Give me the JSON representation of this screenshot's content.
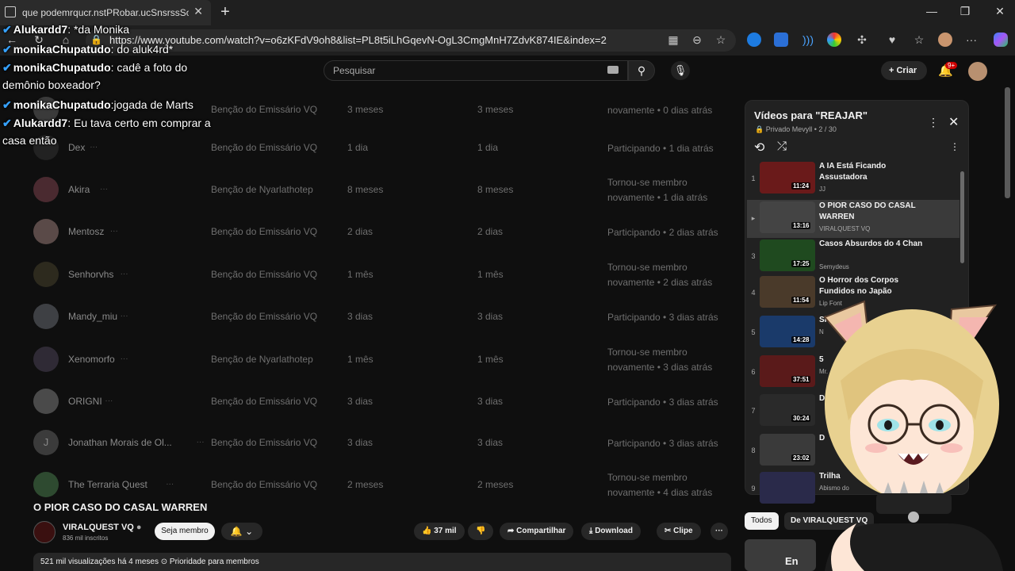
{
  "browser": {
    "tab_title": "que podemrqucr.nstPRobar.ucSnsrssSoCSAL WA",
    "url": "https://www.youtube.com/watch?v=o6zKFdV9oh8&list=PL8t5iLhGqevN-OgL3CmgMnH7ZdvK874IE&index=2"
  },
  "header": {
    "search_placeholder": "Pesquisar",
    "create_label": "Criar",
    "notif_count": "9+"
  },
  "members": [
    {
      "name": "",
      "tier": "Benção do Emissário VQ",
      "t1": "3 meses",
      "t2": "3 meses",
      "status": "novamente • 0 dias atrás",
      "color": "#3a3a3a"
    },
    {
      "name": "Dex",
      "tier": "Benção do Emissário VQ",
      "t1": "1 dia",
      "t2": "1 dia",
      "status": "Participando • 1 dia atrás",
      "color": "#222222"
    },
    {
      "name": "Akira",
      "tier": "Benção de Nyarlathotep",
      "t1": "8 meses",
      "t2": "8 meses",
      "status": "Tornou-se membro novamente • 1 dia atrás",
      "color": "#4a2a30"
    },
    {
      "name": "Mentosz",
      "tier": "Benção do Emissário VQ",
      "t1": "2 dias",
      "t2": "2 dias",
      "status": "Participando • 2 dias atrás",
      "color": "#5a4a48"
    },
    {
      "name": "Senhorvhs",
      "tier": "Benção do Emissário VQ",
      "t1": "1 mês",
      "t2": "1 mês",
      "status": "Tornou-se membro novamente • 2 dias atrás",
      "color": "#2d2a1e"
    },
    {
      "name": "Mandy_miu",
      "tier": "Benção do Emissário VQ",
      "t1": "3 dias",
      "t2": "3 dias",
      "status": "Participando • 3 dias atrás",
      "color": "#3e4044"
    },
    {
      "name": "Xenomorfo",
      "tier": "Benção de Nyarlathotep",
      "t1": "1 mês",
      "t2": "1 mês",
      "status": "Tornou-se membro novamente • 3 dias atrás",
      "color": "#2f2a35"
    },
    {
      "name": "ORIGNI",
      "tier": "Benção do Emissário VQ",
      "t1": "3 dias",
      "t2": "3 dias",
      "status": "Participando • 3 dias atrás",
      "color": "#4a4a4a"
    },
    {
      "name": "Jonathan Morais de Ol...",
      "tier": "Benção do Emissário VQ",
      "t1": "3 dias",
      "t2": "3 dias",
      "status": "Participando • 3 dias atrás",
      "color": "#3b3b3b",
      "initial": "J"
    },
    {
      "name": "The Terraria Quest",
      "tier": "Benção do Emissário VQ",
      "t1": "2 meses",
      "t2": "2 meses",
      "status": "Tornou-se membro novamente • 4 dias atrás",
      "color": "#2e4a30"
    }
  ],
  "playlist": {
    "title": "Vídeos para \"REAJAR\"",
    "sub": "🔒 Privado  Mevyll • 2 / 30",
    "items": [
      {
        "num": "1",
        "title": "A IA Está Ficando Assustadora",
        "channel": "JJ",
        "dur": "11:24",
        "color": "#6a1a1a"
      },
      {
        "num": "▸",
        "title": "O PIOR CASO DO CASAL WARREN",
        "channel": "VIRALQUEST VQ",
        "dur": "13:16",
        "color": "#444444"
      },
      {
        "num": "3",
        "title": "Casos Absurdos do 4 Chan",
        "channel": "Semydeus",
        "dur": "17:25",
        "color": "#1f4a1f"
      },
      {
        "num": "4",
        "title": "O Horror dos Corpos Fundidos no Japão",
        "channel": "Lip Font",
        "dur": "11:54",
        "color": "#4a3a2a"
      },
      {
        "num": "5",
        "title": "Si",
        "channel": "N",
        "dur": "14:28",
        "color": "#1a3a6a"
      },
      {
        "num": "6",
        "title": "5",
        "channel": "Mr.",
        "dur": "37:51",
        "color": "#5a1a1a"
      },
      {
        "num": "7",
        "title": "D",
        "channel": "",
        "dur": "30:24",
        "color": "#2a2a2a"
      },
      {
        "num": "8",
        "title": "D",
        "channel": "",
        "dur": "23:02",
        "color": "#3a3a3a"
      },
      {
        "num": "9",
        "title": "Trilha",
        "channel": "Abismo do",
        "dur": "",
        "color": "#2a2a4a"
      }
    ]
  },
  "chat": [
    {
      "user": "Alukardd7",
      "msg": ": *da Monika"
    },
    {
      "user": "",
      "msg": ""
    },
    {
      "user": "monikaChupatudo",
      "msg": ": do aluk4rd*"
    },
    {
      "user": "monikaChupatudo",
      "msg": ": cadê a foto do"
    },
    {
      "user": "",
      "msg": "demônio boxeador?"
    },
    {
      "user": "monikaChupatudo",
      "msg": ":jogada de Marts"
    },
    {
      "user": "Alukardd7",
      "msg": ": Eu tava certo em comprar a"
    },
    {
      "user": "",
      "msg": "casa então"
    }
  ],
  "video": {
    "title": "O PIOR CASO DO CASAL WARREN",
    "channel": "VIRALQUEST VQ",
    "subs": "836 mil inscritos",
    "join": "Seja membro",
    "likes": "37 mil",
    "share": "Compartilhar",
    "download": "Download",
    "clip": "Clipe",
    "desc": "521 mil visualizações  há 4 meses  ⊙ Prioridade para membros"
  },
  "chips": {
    "all": "Todos",
    "from": "De VIRALQUEST VQ"
  }
}
